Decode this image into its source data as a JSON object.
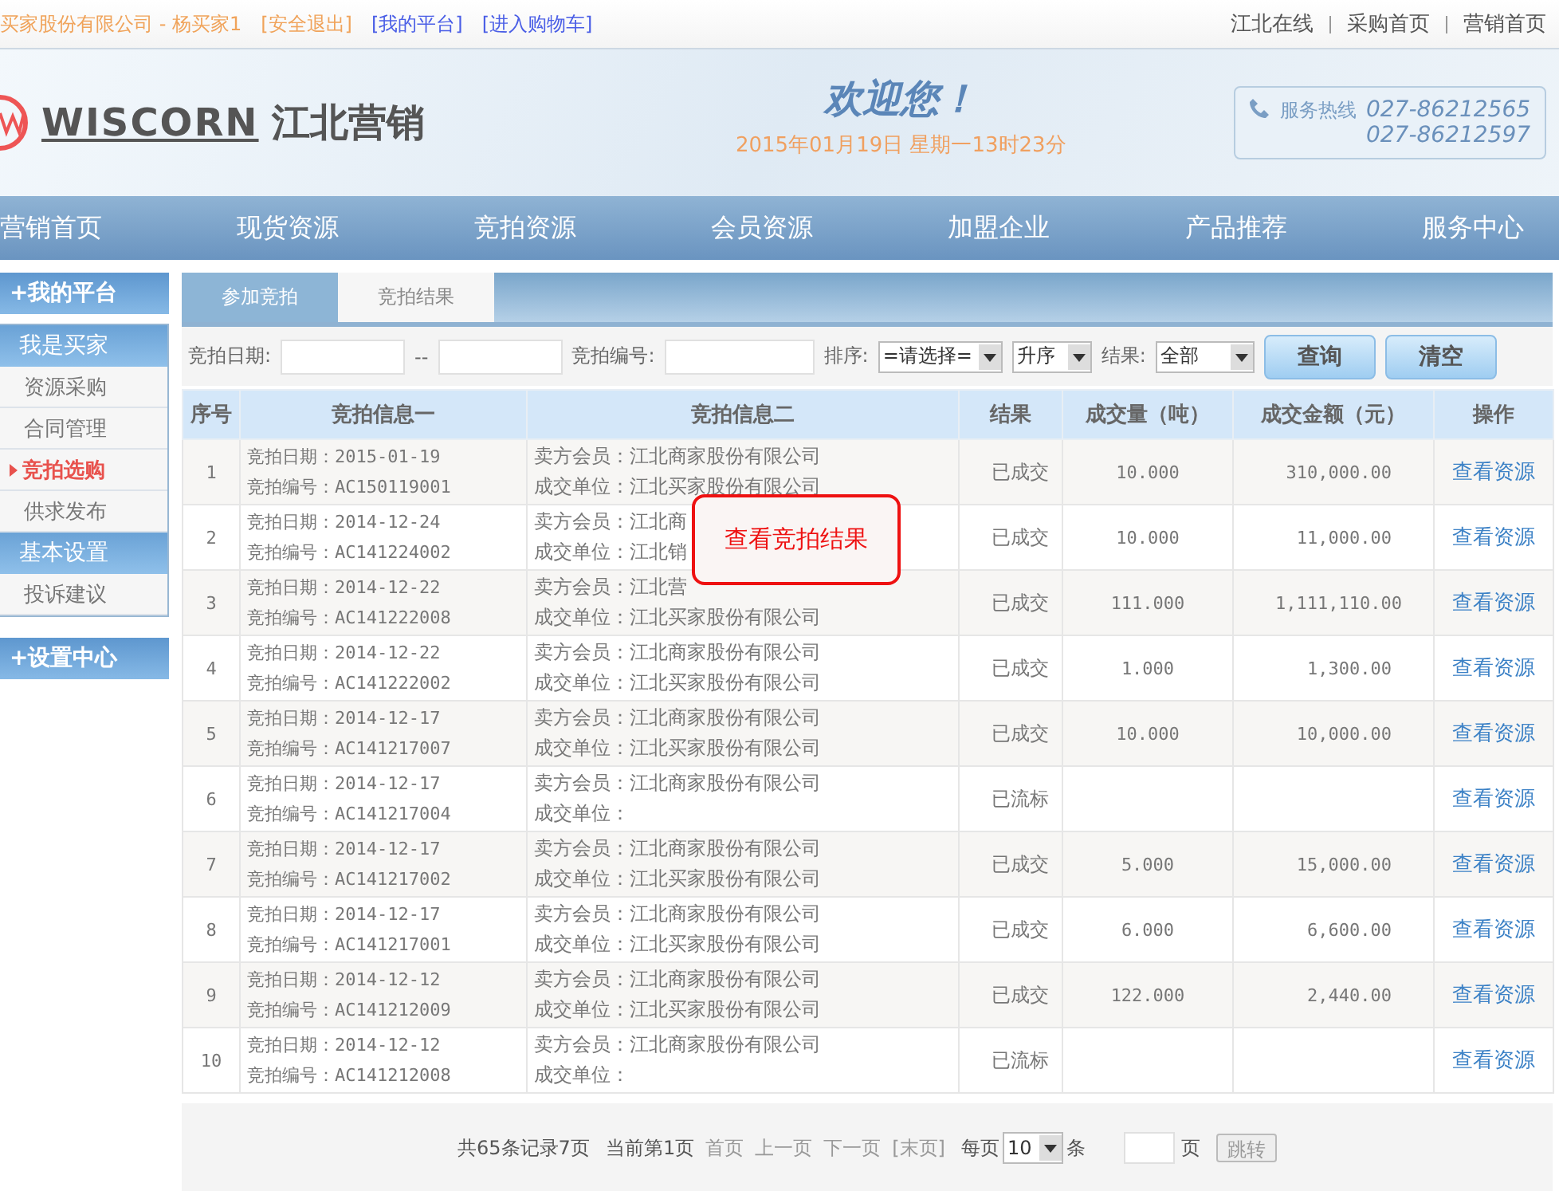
{
  "topbar": {
    "user": "买家股份有限公司 - 杨买家1",
    "links": [
      "[安全退出]",
      "[我的平台]",
      "[进入购物车]"
    ],
    "right_links": [
      "江北在线",
      "采购首页",
      "营销首页"
    ]
  },
  "header": {
    "brand_latin": "WISCORN",
    "brand_cn": "江北营销",
    "welcome": "欢迎您！",
    "datetime": "2015年01月19日 星期一13时23分",
    "hotline_label": "服务热线",
    "phones": [
      "027-86212565",
      "027-86212597"
    ]
  },
  "nav": [
    "营销首页",
    "现货资源",
    "竞拍资源",
    "会员资源",
    "加盟企业",
    "产品推荐",
    "服务中心"
  ],
  "sidebar": {
    "title": "+我的平台",
    "groups": [
      {
        "title": "我是买家",
        "items": [
          {
            "label": "资源采购",
            "selected": false
          },
          {
            "label": "合同管理",
            "selected": false
          },
          {
            "label": "竞拍选购",
            "selected": true
          },
          {
            "label": "供求发布",
            "selected": false
          }
        ]
      },
      {
        "title": "基本设置",
        "items": [
          {
            "label": "投诉建议",
            "selected": false
          }
        ]
      }
    ],
    "footer": "+设置中心"
  },
  "tabs": [
    {
      "label": "参加竞拍",
      "selected": false
    },
    {
      "label": "竞拍结果",
      "selected": true
    }
  ],
  "filters": {
    "date_label": "竞拍日期:",
    "date_sep": "--",
    "code_label": "竞拍编号:",
    "sort_label": "排序:",
    "sort_value": "=请选择=",
    "order_value": "升序",
    "result_label": "结果:",
    "result_value": "全部",
    "buttons": [
      "查询",
      "清空"
    ]
  },
  "table": {
    "columns": [
      "序号",
      "竞拍信息一",
      "竞拍信息二",
      "结果",
      "成交量（吨）",
      "成交金额（元）",
      "操作"
    ],
    "rows": [
      {
        "no": "1",
        "date": "竞拍日期：2015-01-19",
        "code": "竞拍编号：AC150119001",
        "seller": "卖方会员：江北商家股份有限公司",
        "buyer": "成交单位：江北买家股份有限公司",
        "result": "已成交",
        "qty": "10.000",
        "amount": "310,000.00",
        "action": "查看资源"
      },
      {
        "no": "2",
        "date": "竞拍日期：2014-12-24",
        "code": "竞拍编号：AC141224002",
        "seller": "卖方会员：江北商",
        "buyer": "成交单位：江北销",
        "result": "已成交",
        "qty": "10.000",
        "amount": "11,000.00",
        "action": "查看资源"
      },
      {
        "no": "3",
        "date": "竞拍日期：2014-12-22",
        "code": "竞拍编号：AC141222008",
        "seller": "卖方会员：江北营",
        "buyer": "成交单位：江北买家股份有限公司",
        "result": "已成交",
        "qty": "111.000",
        "amount": "1,111,110.00",
        "action": "查看资源"
      },
      {
        "no": "4",
        "date": "竞拍日期：2014-12-22",
        "code": "竞拍编号：AC141222002",
        "seller": "卖方会员：江北商家股份有限公司",
        "buyer": "成交单位：江北买家股份有限公司",
        "result": "已成交",
        "qty": "1.000",
        "amount": "1,300.00",
        "action": "查看资源"
      },
      {
        "no": "5",
        "date": "竞拍日期：2014-12-17",
        "code": "竞拍编号：AC141217007",
        "seller": "卖方会员：江北商家股份有限公司",
        "buyer": "成交单位：江北买家股份有限公司",
        "result": "已成交",
        "qty": "10.000",
        "amount": "10,000.00",
        "action": "查看资源"
      },
      {
        "no": "6",
        "date": "竞拍日期：2014-12-17",
        "code": "竞拍编号：AC141217004",
        "seller": "卖方会员：江北商家股份有限公司",
        "buyer": "成交单位：",
        "result": "已流标",
        "action": "查看资源"
      },
      {
        "no": "7",
        "date": "竞拍日期：2014-12-17",
        "code": "竞拍编号：AC141217002",
        "seller": "卖方会员：江北商家股份有限公司",
        "buyer": "成交单位：江北买家股份有限公司",
        "result": "已成交",
        "qty": "5.000",
        "amount": "15,000.00",
        "action": "查看资源"
      },
      {
        "no": "8",
        "date": "竞拍日期：2014-12-17",
        "code": "竞拍编号：AC141217001",
        "seller": "卖方会员：江北商家股份有限公司",
        "buyer": "成交单位：江北买家股份有限公司",
        "result": "已成交",
        "qty": "6.000",
        "amount": "6,600.00",
        "action": "查看资源"
      },
      {
        "no": "9",
        "date": "竞拍日期：2014-12-12",
        "code": "竞拍编号：AC141212009",
        "seller": "卖方会员：江北商家股份有限公司",
        "buyer": "成交单位：江北买家股份有限公司",
        "result": "已成交",
        "qty": "122.000",
        "amount": "2,440.00",
        "action": "查看资源"
      },
      {
        "no": "10",
        "date": "竞拍日期：2014-12-12",
        "code": "竞拍编号：AC141212008",
        "seller": "卖方会员：江北商家股份有限公司",
        "buyer": "成交单位：",
        "result": "已流标",
        "action": "查看资源"
      }
    ]
  },
  "popup": {
    "text": "查看竞拍结果"
  },
  "pagination": {
    "summary": "共65条记录7页",
    "current": "当前第1页",
    "links": [
      "首页",
      "上一页",
      "下一页",
      "[末页]"
    ],
    "per_page_label": "每页",
    "per_page_value": "10",
    "per_page_unit": "条",
    "page_unit": "页",
    "jump": "跳转"
  }
}
